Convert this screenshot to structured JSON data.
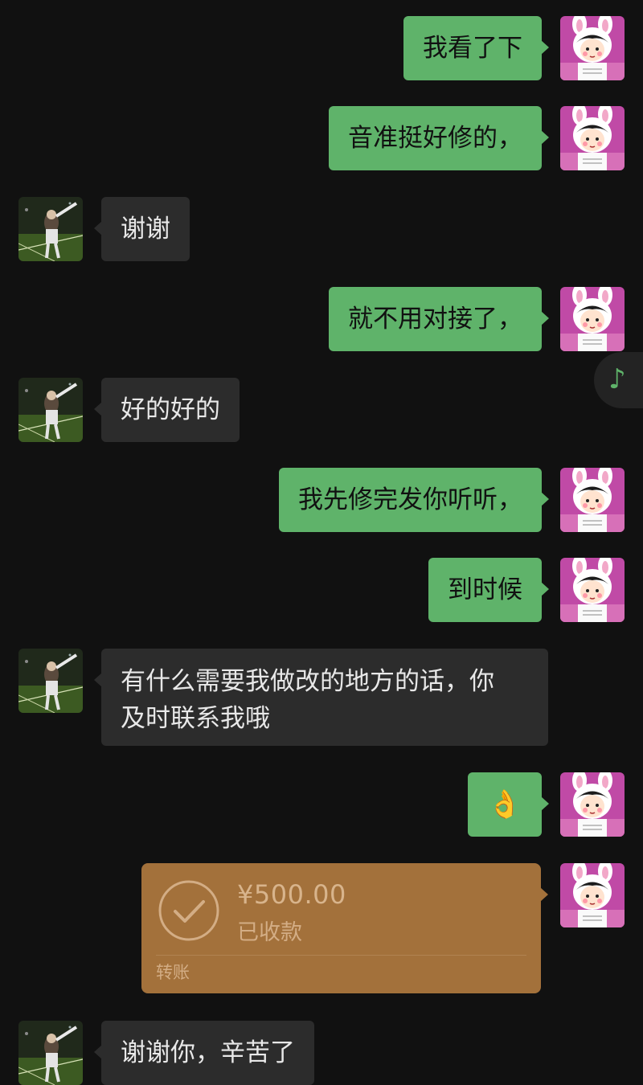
{
  "messages": [
    {
      "id": "m1",
      "sender": "me",
      "text": "我看了下"
    },
    {
      "id": "m2",
      "sender": "me",
      "text": "音准挺好修的，"
    },
    {
      "id": "m3",
      "sender": "them",
      "text": "谢谢"
    },
    {
      "id": "m4",
      "sender": "me",
      "text": "就不用对接了，"
    },
    {
      "id": "m5",
      "sender": "them",
      "text": "好的好的"
    },
    {
      "id": "m6",
      "sender": "me",
      "text": "我先修完发你听听，"
    },
    {
      "id": "m7",
      "sender": "me",
      "text": "到时候"
    },
    {
      "id": "m8",
      "sender": "them",
      "line1": "有什么需要我做改的地方的话，你",
      "line2": "及时联系我哦"
    },
    {
      "id": "m9",
      "sender": "me",
      "emoji": "👌"
    },
    {
      "id": "m10",
      "sender": "me",
      "type": "transfer",
      "amount": "¥500.00",
      "status": "已收款",
      "label": "转账"
    },
    {
      "id": "m11",
      "sender": "them",
      "text": "谢谢你，辛苦了"
    }
  ],
  "floating": {
    "icon": "music-note-icon",
    "glyph": "♪"
  },
  "colors": {
    "background": "#111111",
    "my_bubble": "#5fb36a",
    "their_bubble": "#2c2c2c",
    "transfer": "#a3713b"
  }
}
